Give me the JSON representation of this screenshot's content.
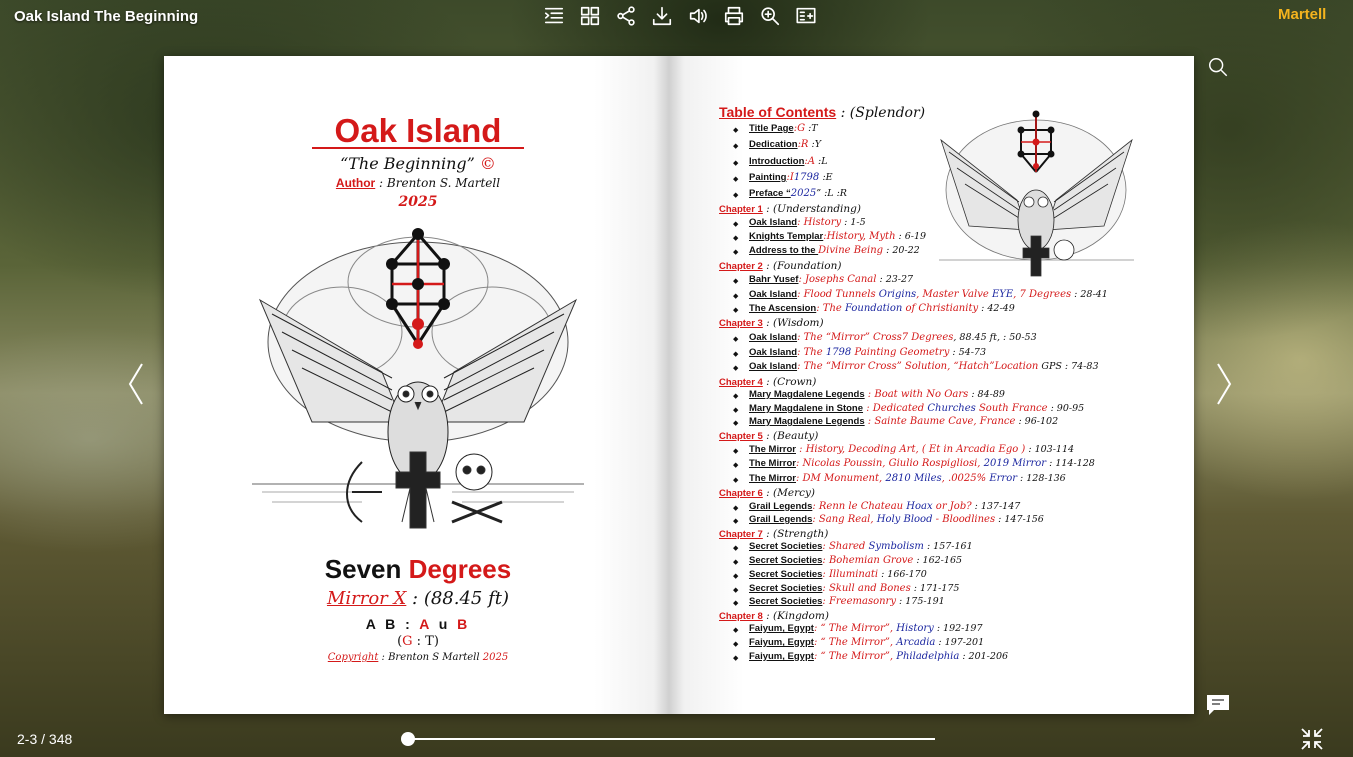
{
  "header": {
    "title": "Oak Island The Beginning",
    "brand": "Martell"
  },
  "toolbar": [
    "table-of-contents-icon",
    "thumbnails-icon",
    "share-icon",
    "download-icon",
    "sound-icon",
    "print-icon",
    "zoom-icon",
    "add-note-icon"
  ],
  "left_page": {
    "title": "Oak Island",
    "subtitle": "“The Beginning”",
    "copyright_mark": "©",
    "author_label": "Author",
    "author_sep": " : ",
    "author_name": "Brenton S. Martell",
    "year": "2025",
    "seven": "Seven ",
    "degrees": "Degrees",
    "mirror_label": "Mirror X",
    "mirror_rest": " : (88.45 ft)",
    "ab_left": "A B : ",
    "ab_a": "A",
    "ab_u": " u ",
    "ab_b": "B",
    "gt_open": "(",
    "gt_g": "G",
    "gt_rest": " : T)",
    "copyright_label": "Copyright",
    "copyright_name": " : Brenton S Martell ",
    "copyright_year": "2025"
  },
  "right_page": {
    "toc_label": "Table of Contents",
    "toc_suffix": " : (Splendor)",
    "front": [
      {
        "k": "Title Page",
        "v": ":G",
        "p": " :T"
      },
      {
        "k": "Dedication",
        "v": ":R",
        "p": " :Y"
      },
      {
        "k": "Introduction",
        "v": ":A",
        "p": " :L"
      },
      {
        "k": "Painting",
        "b": "1798 ",
        "v": ":I",
        "p": " :E"
      },
      {
        "k": "Preface “",
        "b": "2025",
        "p": "” :L :R"
      }
    ],
    "chapters": [
      {
        "label": "Chapter 1",
        "sub": " : (Understanding)",
        "items": [
          {
            "k": "Oak Island",
            "v": ": History",
            "p": " : 1-5"
          },
          {
            "k": "Knights Templar",
            "v": ":History, Myth",
            "p": " : 6-19"
          },
          {
            "k": "Address to the ",
            "v": "Divine Being",
            "p": " : 20-22"
          }
        ]
      },
      {
        "label": "Chapter 2",
        "sub": " : (Foundation)",
        "items": [
          {
            "k": "Bahr Yusef",
            "v": ": Josephs Canal",
            "p": " : 23-27"
          },
          {
            "k": "Oak Island",
            "v": ": Flood Tunnels ",
            "b": "Origins",
            "v2": ", Master Valve ",
            "b2": "EYE",
            "v3": ", 7 Degrees",
            "p": " : 28-41"
          },
          {
            "k": "The Ascension",
            "v": ": The ",
            "b": "Foundation",
            "v2": " of Christianity",
            "p": " : 42-49"
          }
        ]
      },
      {
        "label": "Chapter 3",
        "sub": " : (Wisdom)",
        "items": [
          {
            "k": "Oak Island",
            "v": ": The “Mirror” Cross",
            "p": ", 88.45 ft, ",
            "v2": "7 Degrees",
            "p2": " : 50-53"
          },
          {
            "k": "Oak Island",
            "v": ": The ",
            "b": "1798",
            "v2": " Painting Geometry",
            "p": " : 54-73"
          },
          {
            "k": "Oak Island",
            "v": ": The “Mirror Cross” Solution, “Hatch”",
            "p": " GPS ",
            "v2": "Location",
            "p2": " : 74-83"
          }
        ]
      },
      {
        "label": "Chapter 4",
        "sub": " : (Crown)",
        "items": [
          {
            "k": "Mary Magdalene Legends",
            "v": " : Boat with No Oars",
            "p": " : 84-89"
          },
          {
            "k": "Mary Magdalene in Stone",
            "v": " : Dedicated ",
            "b": "Churches",
            "v2": " South France",
            "p": " : 90-95"
          },
          {
            "k": "Mary Magdalene Legends",
            "v": " : Sainte Baume Cave, France",
            "p": " : 96-102"
          }
        ]
      },
      {
        "label": "Chapter 5",
        "sub": " : (Beauty)",
        "items": [
          {
            "k": "The Mirror",
            "v": " : History, Decoding Art, ( Et in Arcadia Ego )",
            "p": " : 103-114"
          },
          {
            "k": "The Mirror",
            "v": ": Nicolas Poussin, Giulio Rospigliosi, ",
            "b": "2019 Mirror",
            "p": " : 114-128"
          },
          {
            "k": "The Mirror",
            "v": ": DM Monument, ",
            "b": "2810 Miles",
            "v2": ", .0025% ",
            "b2": "Error",
            "p": " : 128-136"
          }
        ]
      },
      {
        "label": "Chapter 6",
        "sub": " : (Mercy)",
        "items": [
          {
            "k": "Grail Legends",
            "v": ": Renn le Chateau ",
            "b": "Hoax",
            "v2": " or Job?",
            "p": " : 137-147"
          },
          {
            "k": "Grail Legends",
            "v": ": Sang Real, ",
            "b": "Holy Blood",
            "v2": " - Bloodlines",
            "p": " : 147-156"
          }
        ]
      },
      {
        "label": "Chapter 7",
        "sub": " : (Strength)",
        "items": [
          {
            "k": "Secret Societies",
            "v": ": Shared ",
            "b": "Symbolism",
            "p": " : 157-161"
          },
          {
            "k": "Secret Societies",
            "v": ": Bohemian Grove",
            "p": " : 162-165"
          },
          {
            "k": "Secret Societies",
            "v": ": Illuminati",
            "p": " : 166-170"
          },
          {
            "k": "Secret Societies",
            "v": ": Skull and Bones",
            "p": " : 171-175"
          },
          {
            "k": "Secret Societies",
            "v": ": Freemasonry",
            "p": " : 175-191"
          }
        ]
      },
      {
        "label": "Chapter 8",
        "sub": " : (Kingdom)",
        "items": [
          {
            "k": "Faiyum, Egypt",
            "v": ": “ The Mirror”, ",
            "b": "History",
            "p": " : 192-197"
          },
          {
            "k": "Faiyum, Egypt",
            "v": ": “ The Mirror”, ",
            "b": "Arcadia",
            "p": " : 197-201"
          },
          {
            "k": "Faiyum, Egypt",
            "v": ": “ The Mirror”, ",
            "b": "Philadelphia",
            "p": " : 201-206"
          }
        ]
      }
    ]
  },
  "footer": {
    "page_indicator": "2-3 / 348",
    "progress": 0.006
  },
  "colors": {
    "accent_red": "#d41919",
    "accent_blue": "#1c27a0",
    "brand": "#f3b31e"
  }
}
